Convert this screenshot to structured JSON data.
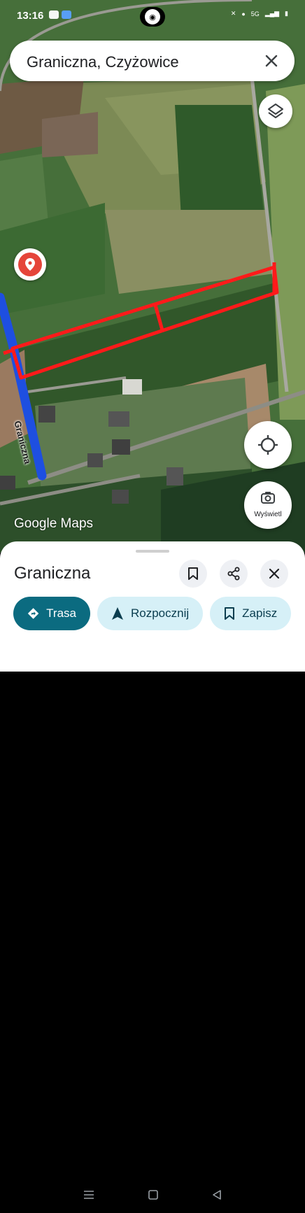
{
  "status_bar": {
    "time": "13:16",
    "network": "5G"
  },
  "search": {
    "query": "Graniczna, Czyżowice"
  },
  "map": {
    "street_label": "Graniczna",
    "logo_text": "Google Maps",
    "view_button_label": "Wyświetl",
    "colors": {
      "road_highlight": "#1e4fe0",
      "parcel_outline": "#ff1a1a",
      "pin": "#e5453a"
    }
  },
  "place": {
    "title": "Graniczna",
    "actions": [
      {
        "label": "Trasa",
        "icon": "directions-icon"
      },
      {
        "label": "Rozpocznij",
        "icon": "navigation-arrow-icon"
      },
      {
        "label": "Zapisz",
        "icon": "bookmark-icon"
      }
    ]
  },
  "colors": {
    "accent": "#0b6b80",
    "chip_bg": "#d6f0f7"
  }
}
